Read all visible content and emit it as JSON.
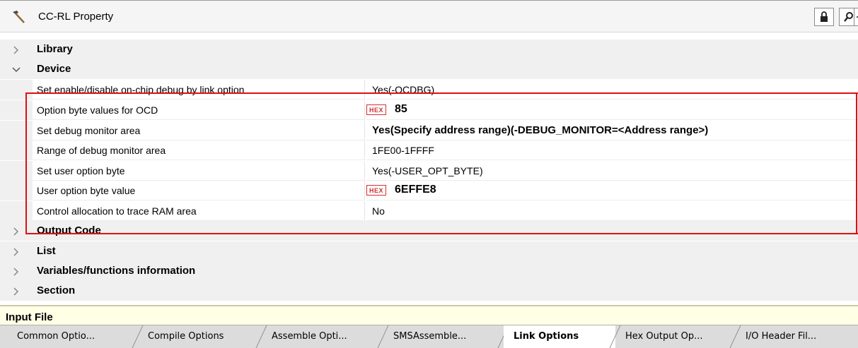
{
  "panel": {
    "title": "CC-RL Property",
    "lock_icon": "lock-icon",
    "search_icon": "search-icon",
    "minimize_icon": "minimize-icon"
  },
  "categories": {
    "library": "Library",
    "device": "Device",
    "output_code": "Output Code",
    "list": "List",
    "variables": "Variables/functions information",
    "section": "Section"
  },
  "device_props": [
    {
      "name": "Set enable/disable on-chip debug by link option",
      "value": "Yes(-OCDBG)"
    },
    {
      "name": "Option byte values for OCD",
      "value": "85",
      "badge": "HEX"
    },
    {
      "name": "Set debug monitor area",
      "value": "Yes(Specify address range)(-DEBUG_MONITOR=<Address range>)"
    },
    {
      "name": "Range of debug monitor area",
      "value": "1FE00-1FFFF"
    },
    {
      "name": "Set user option byte",
      "value": "Yes(-USER_OPT_BYTE)"
    },
    {
      "name": "User option byte value",
      "value": "6EFFE8",
      "badge": "HEX"
    },
    {
      "name": "Control allocation to trace RAM area",
      "value": "No"
    }
  ],
  "description": {
    "title": "Input File"
  },
  "tabs": [
    {
      "label": "Common Optio..."
    },
    {
      "label": "Compile Options"
    },
    {
      "label": "Assemble Opti..."
    },
    {
      "label": "SMSAssemble..."
    },
    {
      "label": "Link Options"
    },
    {
      "label": "Hex Output Op..."
    },
    {
      "label": "I/O Header Fil..."
    }
  ],
  "colors": {
    "highlight_border": "#e01010",
    "hex_badge": "#d03030",
    "description_bg": "#ffffe6"
  }
}
